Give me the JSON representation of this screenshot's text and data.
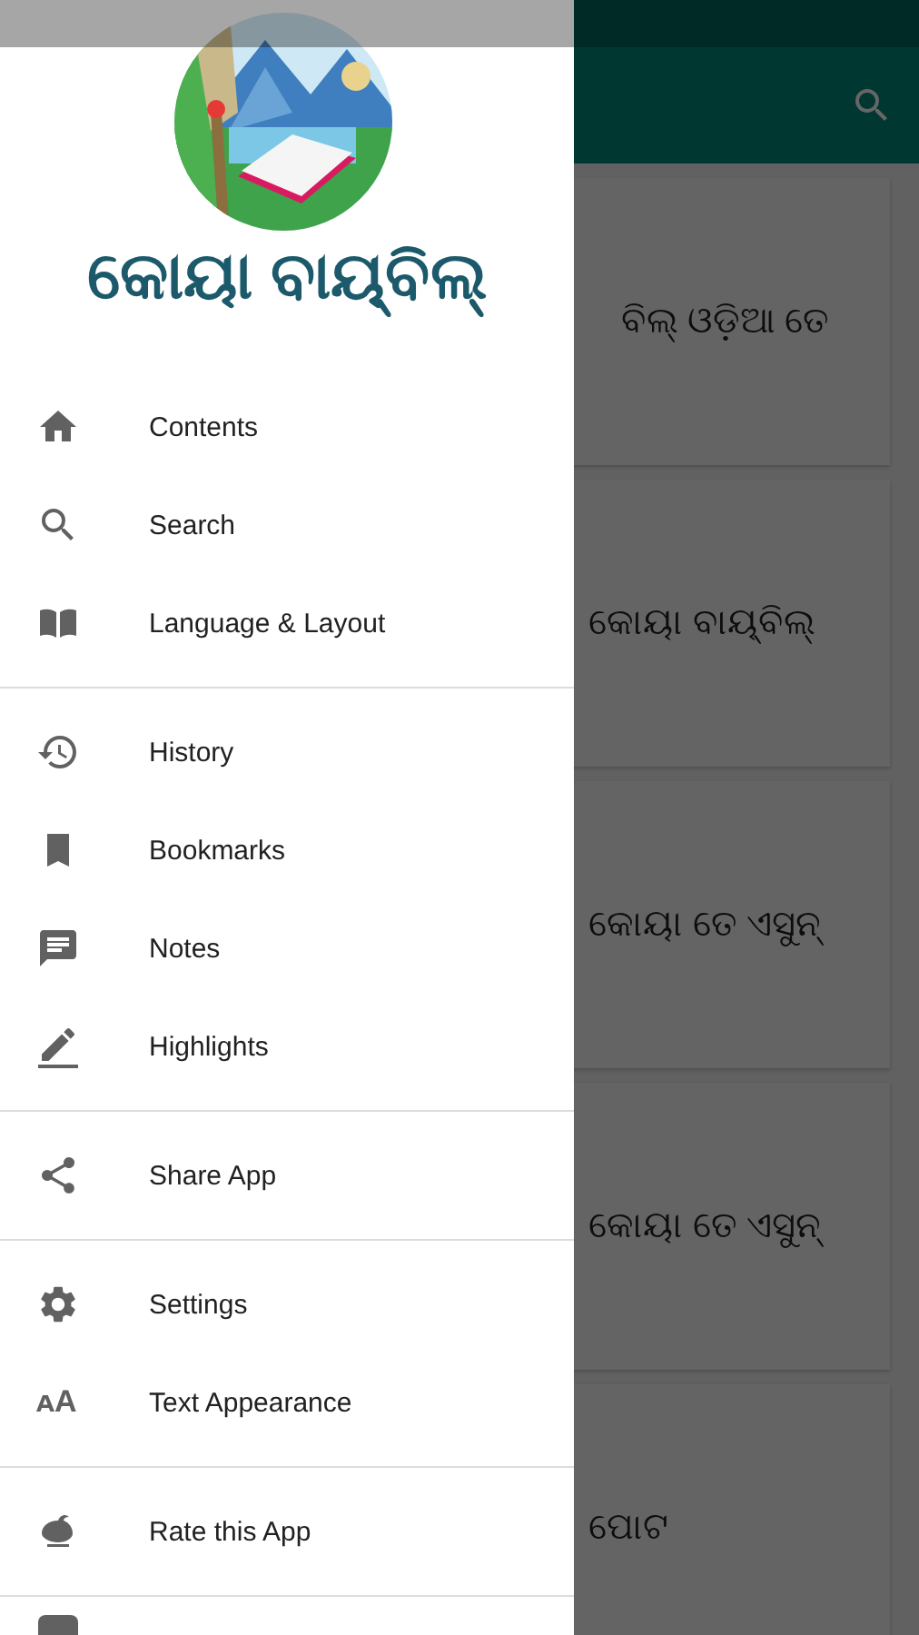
{
  "app_bar": {
    "search_icon": true
  },
  "cards": [
    {
      "text": "ବିଲ୍ ଓଡ଼ିଆ ତେ"
    },
    {
      "text": "କୋୟା ବାୟ୍‌ବିଲ୍"
    },
    {
      "text": "କୋୟା ତେ ଏସୁନ୍"
    },
    {
      "text": "କୋୟା ତେ ଏସୁନ୍"
    },
    {
      "text": "ପୋଟ"
    }
  ],
  "drawer": {
    "title": "କୋୟା ବାୟ୍‌ବିଲ୍",
    "groups": [
      [
        {
          "label": "Contents"
        },
        {
          "label": "Search"
        },
        {
          "label": "Language & Layout"
        }
      ],
      [
        {
          "label": "History"
        },
        {
          "label": "Bookmarks"
        },
        {
          "label": "Notes"
        },
        {
          "label": "Highlights"
        }
      ],
      [
        {
          "label": "Share App"
        }
      ],
      [
        {
          "label": "Settings"
        },
        {
          "label": "Text Appearance",
          "glyph": "ᴀA"
        }
      ],
      [
        {
          "label": "Rate this App"
        }
      ]
    ]
  }
}
